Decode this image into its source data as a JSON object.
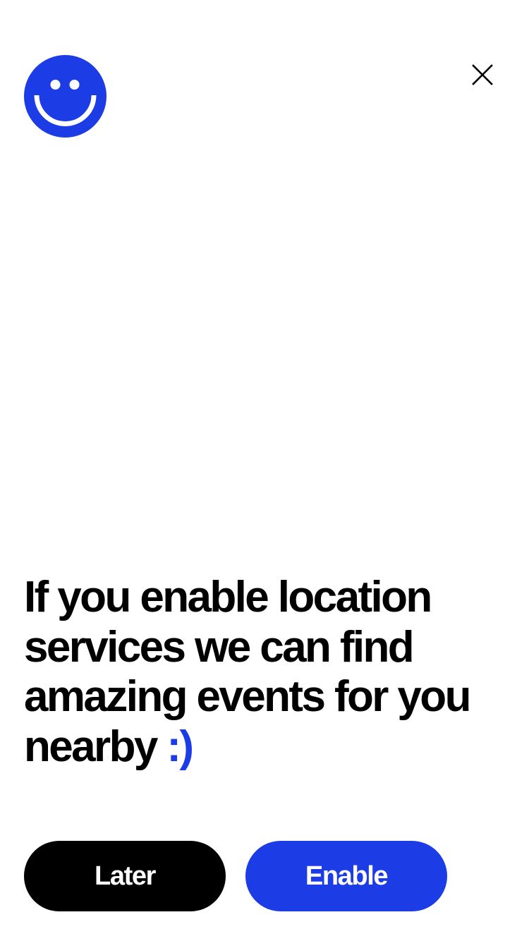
{
  "header": {
    "logo_icon": "smiley-face-icon",
    "close_icon": "close-icon"
  },
  "message": {
    "text": "If you enable location services we can find amazing events for you nearby",
    "emoticon": ":)"
  },
  "actions": {
    "later_label": "Later",
    "enable_label": "Enable"
  },
  "colors": {
    "accent": "#1c3ce6",
    "primary_text": "#000000",
    "later_button": "#000000",
    "background": "#ffffff"
  }
}
